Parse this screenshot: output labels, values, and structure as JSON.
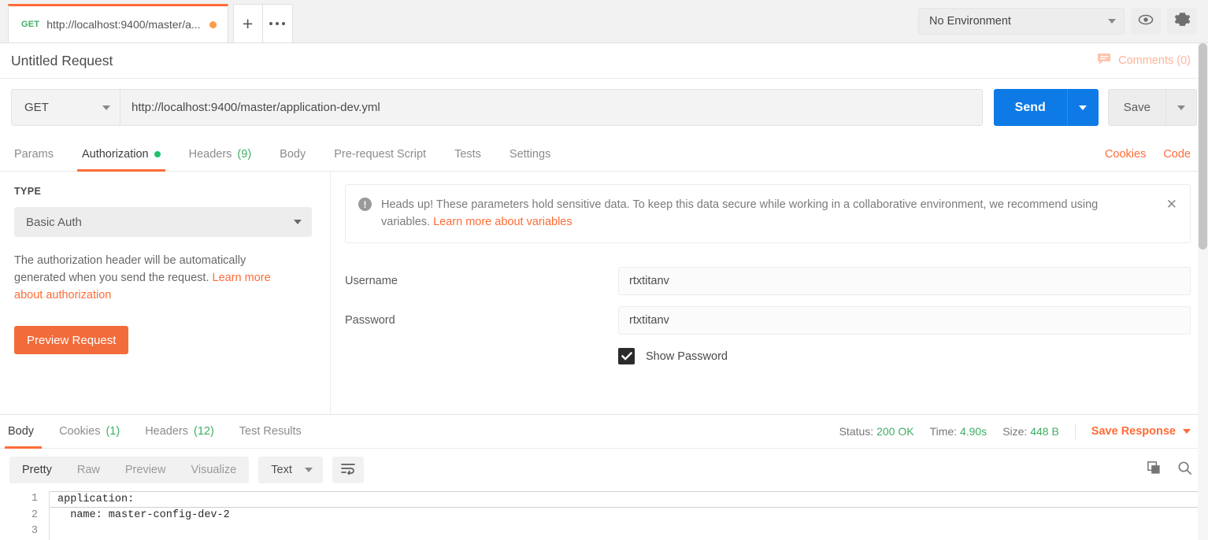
{
  "tabbar": {
    "request_tab": {
      "method": "GET",
      "url": "http://localhost:9400/master/a...",
      "unsaved": "unsaved-dot"
    },
    "new_tab_label": "+",
    "more_label": "•••",
    "environment": {
      "selected": "No Environment"
    },
    "eye_icon": "eye-icon",
    "gear_icon": "gear-icon"
  },
  "title": {
    "name": "Untitled Request",
    "comments": "Comments (0)"
  },
  "urlbar": {
    "method": "GET",
    "url": "http://localhost:9400/master/application-dev.yml",
    "send_label": "Send",
    "save_label": "Save",
    "send_color": "#0d7ae6"
  },
  "request_tabs": {
    "items": [
      {
        "label": "Params",
        "count": "",
        "active": false
      },
      {
        "label": "Authorization",
        "count": "",
        "active": true
      },
      {
        "label": "Headers",
        "count": "(9)",
        "active": false
      },
      {
        "label": "Body",
        "count": "",
        "active": false
      },
      {
        "label": "Pre-request Script",
        "count": "",
        "active": false
      },
      {
        "label": "Tests",
        "count": "",
        "active": false
      },
      {
        "label": "Settings",
        "count": "",
        "active": false
      }
    ],
    "cookies_link": "Cookies",
    "code_link": "Code",
    "accent": "#ff6c37"
  },
  "auth": {
    "type_label": "TYPE",
    "type_value": "Basic Auth",
    "description": "The authorization header will be automatically generated when you send the request. ",
    "description_link": "Learn more about authorization",
    "preview_button": "Preview Request",
    "banner": {
      "text": "Heads up! These parameters hold sensitive data. To keep this data secure while working in a collaborative environment, we recommend using variables. ",
      "link": "Learn more about variables",
      "close": "✕"
    },
    "fields": [
      {
        "label": "Username",
        "value": "rtxtitanv"
      },
      {
        "label": "Password",
        "value": "rtxtitanv"
      }
    ],
    "show_password_label": "Show Password",
    "show_password_checked": true
  },
  "response": {
    "tabs": [
      {
        "label": "Body",
        "count": "",
        "active": true
      },
      {
        "label": "Cookies",
        "count": "(1)",
        "active": false
      },
      {
        "label": "Headers",
        "count": "(12)",
        "active": false
      },
      {
        "label": "Test Results",
        "count": "",
        "active": false
      }
    ],
    "status_label": "Status:",
    "status_value": "200 OK",
    "time_label": "Time:",
    "time_value": "4.90s",
    "size_label": "Size:",
    "size_value": "448 B",
    "save_response": "Save Response",
    "toolbar": {
      "views": [
        "Pretty",
        "Raw",
        "Preview",
        "Visualize"
      ],
      "active_view": "Pretty",
      "format": "Text",
      "wrap_icon": "word-wrap-icon",
      "copy_icon": "copy-icon",
      "search_icon": "search-icon"
    },
    "body_lines": [
      "application:",
      "  name: master-config-dev-2",
      ""
    ],
    "line_numbers": [
      "1",
      "2",
      "3"
    ]
  }
}
